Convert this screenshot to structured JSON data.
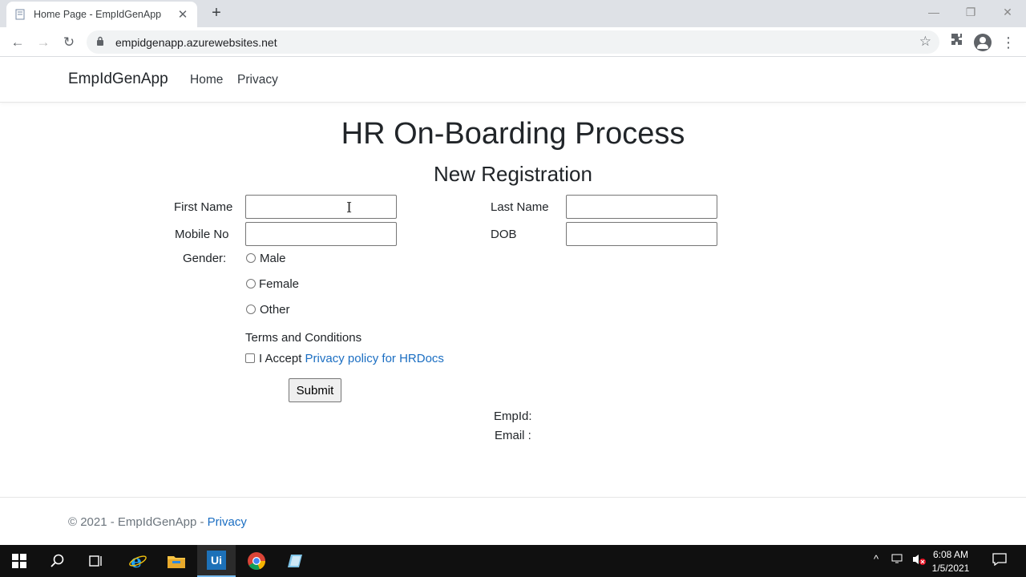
{
  "browser": {
    "tab_title": "Home Page - EmpIdGenApp",
    "url": "empidgenapp.azurewebsites.net"
  },
  "navbar": {
    "brand": "EmpIdGenApp",
    "links": [
      "Home",
      "Privacy"
    ]
  },
  "page": {
    "title": "HR On-Boarding Process",
    "subtitle": "New Registration"
  },
  "form": {
    "first_name_label": "First Name",
    "first_name_value": "",
    "last_name_label": "Last Name",
    "last_name_value": "",
    "mobile_label": "Mobile No",
    "mobile_value": "",
    "dob_label": "DOB",
    "dob_value": "",
    "gender_label": "Gender:",
    "gender_options": [
      "Male",
      "Female",
      "Other"
    ],
    "terms_heading": "Terms and Conditions",
    "accept_text": "I Accept",
    "privacy_link": "Privacy policy for HRDocs",
    "submit_label": "Submit"
  },
  "result": {
    "empid_label": "EmpId:",
    "empid_value": "",
    "email_label": "Email :",
    "email_value": ""
  },
  "footer": {
    "copyright": "© 2021 - EmpIdGenApp - ",
    "privacy_link": "Privacy"
  },
  "taskbar": {
    "time": "6:08 AM",
    "date": "1/5/2021"
  },
  "colors": {
    "link": "#1b6ec2",
    "taskbar": "#101010"
  }
}
